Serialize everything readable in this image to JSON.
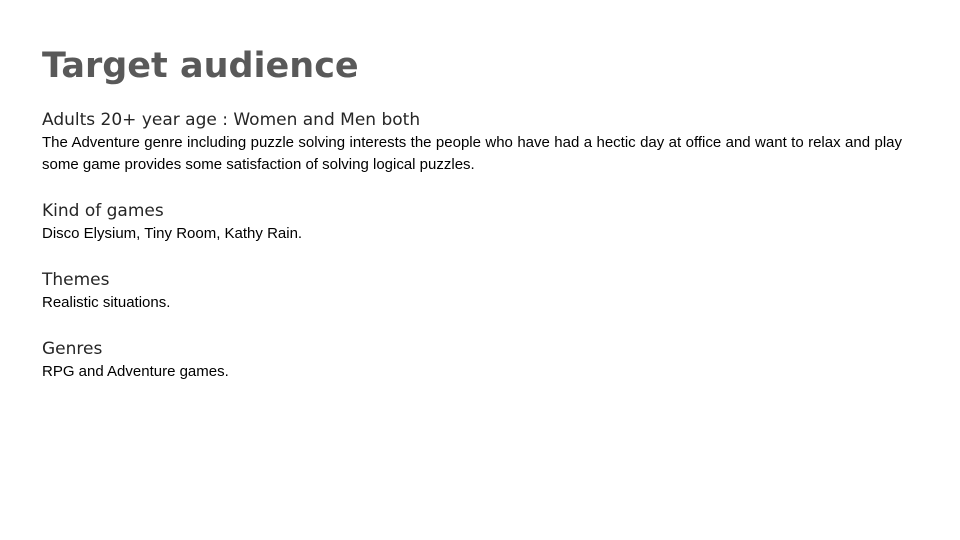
{
  "slide": {
    "title": "Target audience",
    "sections": [
      {
        "heading": "Adults 20+ year age : Women and Men both",
        "body": "The Adventure genre including puzzle solving interests the people who have had a hectic day at office and want to relax and play some game provides some satisfaction of solving logical puzzles."
      },
      {
        "heading": "Kind of games",
        "body": "Disco Elysium, Tiny Room, Kathy Rain."
      },
      {
        "heading": "Themes",
        "body": "Realistic situations."
      },
      {
        "heading": "Genres",
        "body": "RPG and Adventure games."
      }
    ]
  },
  "colors": {
    "title": "#595959",
    "heading": "#262626",
    "body": "#000000",
    "background": "#ffffff"
  }
}
